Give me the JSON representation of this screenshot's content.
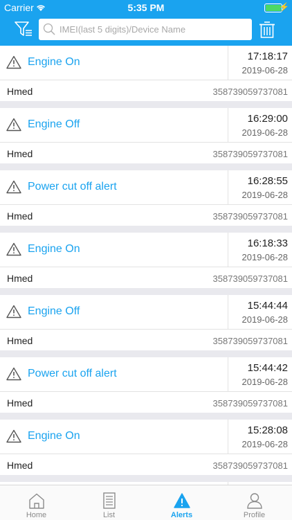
{
  "status": {
    "carrier": "Carrier",
    "time": "5:35 PM"
  },
  "search": {
    "placeholder": "IMEI(last 5 digits)/Device Name",
    "value": ""
  },
  "alerts": [
    {
      "type": "Engine On",
      "time": "17:18:17",
      "date": "2019-06-28",
      "device": "Hmed",
      "imei": "358739059737081"
    },
    {
      "type": "Engine Off",
      "time": "16:29:00",
      "date": "2019-06-28",
      "device": "Hmed",
      "imei": "358739059737081"
    },
    {
      "type": "Power cut off alert",
      "time": "16:28:55",
      "date": "2019-06-28",
      "device": "Hmed",
      "imei": "358739059737081"
    },
    {
      "type": "Engine On",
      "time": "16:18:33",
      "date": "2019-06-28",
      "device": "Hmed",
      "imei": "358739059737081"
    },
    {
      "type": "Engine Off",
      "time": "15:44:44",
      "date": "2019-06-28",
      "device": "Hmed",
      "imei": "358739059737081"
    },
    {
      "type": "Power cut off alert",
      "time": "15:44:42",
      "date": "2019-06-28",
      "device": "Hmed",
      "imei": "358739059737081"
    },
    {
      "type": "Engine On",
      "time": "15:28:08",
      "date": "2019-06-28",
      "device": "Hmed",
      "imei": "358739059737081"
    },
    {
      "type": "",
      "time": "",
      "date": "",
      "device": "",
      "imei": ""
    }
  ],
  "tabs": [
    {
      "label": "Home",
      "icon": "home-icon"
    },
    {
      "label": "List",
      "icon": "list-icon"
    },
    {
      "label": "Alerts",
      "icon": "alert-icon",
      "active": true
    },
    {
      "label": "Profile",
      "icon": "person-icon"
    }
  ],
  "colors": {
    "accent": "#1aa3ef",
    "background": "#e9e9ee",
    "battery": "#4cd964"
  }
}
